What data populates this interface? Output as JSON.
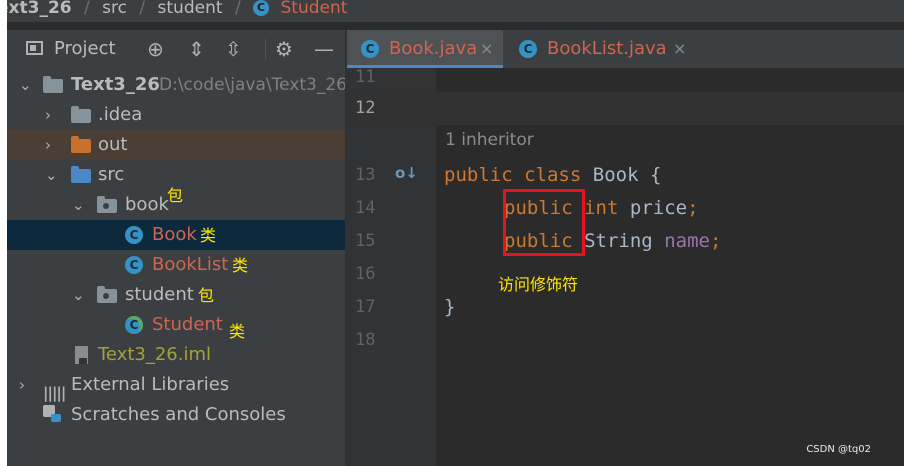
{
  "breadcrumb": {
    "items": [
      "ext3_26",
      "src",
      "student",
      "Student"
    ],
    "separator": "/",
    "class_icon_glyph": "C"
  },
  "project_panel": {
    "title": "Project",
    "tool_icons": [
      "locate-icon",
      "expand-all-icon",
      "collapse-all-icon",
      "gear-icon",
      "minimize-icon"
    ],
    "tool_glyphs": [
      "⊕",
      "⇕",
      "⇳",
      "⚙",
      "—"
    ],
    "tree": {
      "root": {
        "label": "Text3_26",
        "path": "D:\\code\\java\\Text3_26"
      },
      "idea": {
        "label": ".idea"
      },
      "out": {
        "label": "out"
      },
      "src": {
        "label": "src"
      },
      "book_pkg": {
        "label": "book",
        "note": "包"
      },
      "book_class": {
        "label": "Book",
        "note": "类"
      },
      "booklist_class": {
        "label": "BookList",
        "note": "类"
      },
      "student_pkg": {
        "label": "student",
        "note": "包"
      },
      "student_class": {
        "label": "Student",
        "note": "类"
      },
      "iml": {
        "label": "Text3_26.iml"
      },
      "external": {
        "label": "External Libraries"
      },
      "scratches": {
        "label": "Scratches and Consoles"
      }
    },
    "glyphs": {
      "expanded": "⌄",
      "collapsed": "›",
      "class": "C"
    }
  },
  "tabs": [
    {
      "label": "Book.java",
      "close": "×",
      "active": true
    },
    {
      "label": "BookList.java",
      "close": "×",
      "active": false
    }
  ],
  "editor": {
    "line_numbers": [
      "11",
      "12",
      "13",
      "14",
      "15",
      "16",
      "17",
      "18"
    ],
    "inlay_hint": "1 inheritor",
    "gutter_marker": "o↓",
    "code": {
      "l13": {
        "k1": "public",
        "k2": "class",
        "name": "Book {"
      },
      "l14": {
        "mod": "public",
        "type": "int",
        "field": "price",
        "semi": ";"
      },
      "l15": {
        "mod": "public",
        "type": "String",
        "field": "name",
        "semi": ";"
      },
      "l17": {
        "brace": "}"
      }
    },
    "annotation": "访问修饰符"
  },
  "watermark": "CSDN @tq02",
  "colors": {
    "keyword": "#cc7832",
    "field": "#9876aa",
    "annotation_box": "#e5121f",
    "note": "#ffe600",
    "file_red": "#d0644f"
  }
}
